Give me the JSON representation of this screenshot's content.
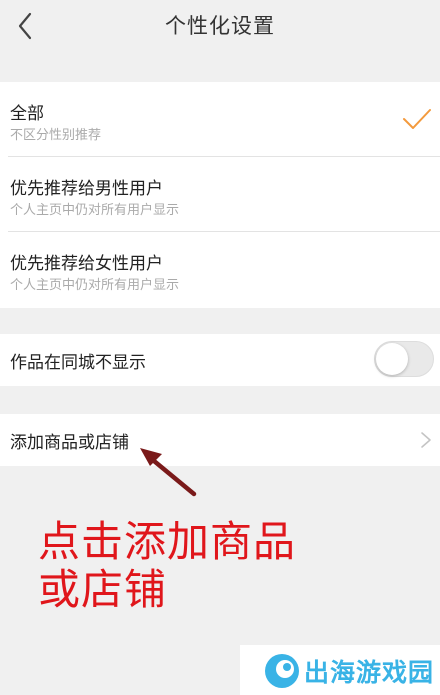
{
  "header": {
    "title": "个性化设置",
    "back_icon": "chevron-left-icon"
  },
  "recommend_options": [
    {
      "title": "全部",
      "subtitle": "不区分性别推荐",
      "selected": true
    },
    {
      "title": "优先推荐给男性用户",
      "subtitle": "个人主页中仍对所有用户显示",
      "selected": false
    },
    {
      "title": "优先推荐给女性用户",
      "subtitle": "个人主页中仍对所有用户显示",
      "selected": false
    }
  ],
  "city_toggle": {
    "label": "作品在同城不显示",
    "enabled": false
  },
  "add_goods": {
    "label": "添加商品或店铺",
    "icon": "chevron-right-icon"
  },
  "annotation": {
    "line1": "点击添加商品",
    "line2": "或店铺",
    "color": "#e0161b"
  },
  "watermark": {
    "text": "出海游戏园",
    "color": "#39b3e6"
  },
  "colors": {
    "accent_check": "#f39a3d",
    "background": "#f0f0f0"
  }
}
